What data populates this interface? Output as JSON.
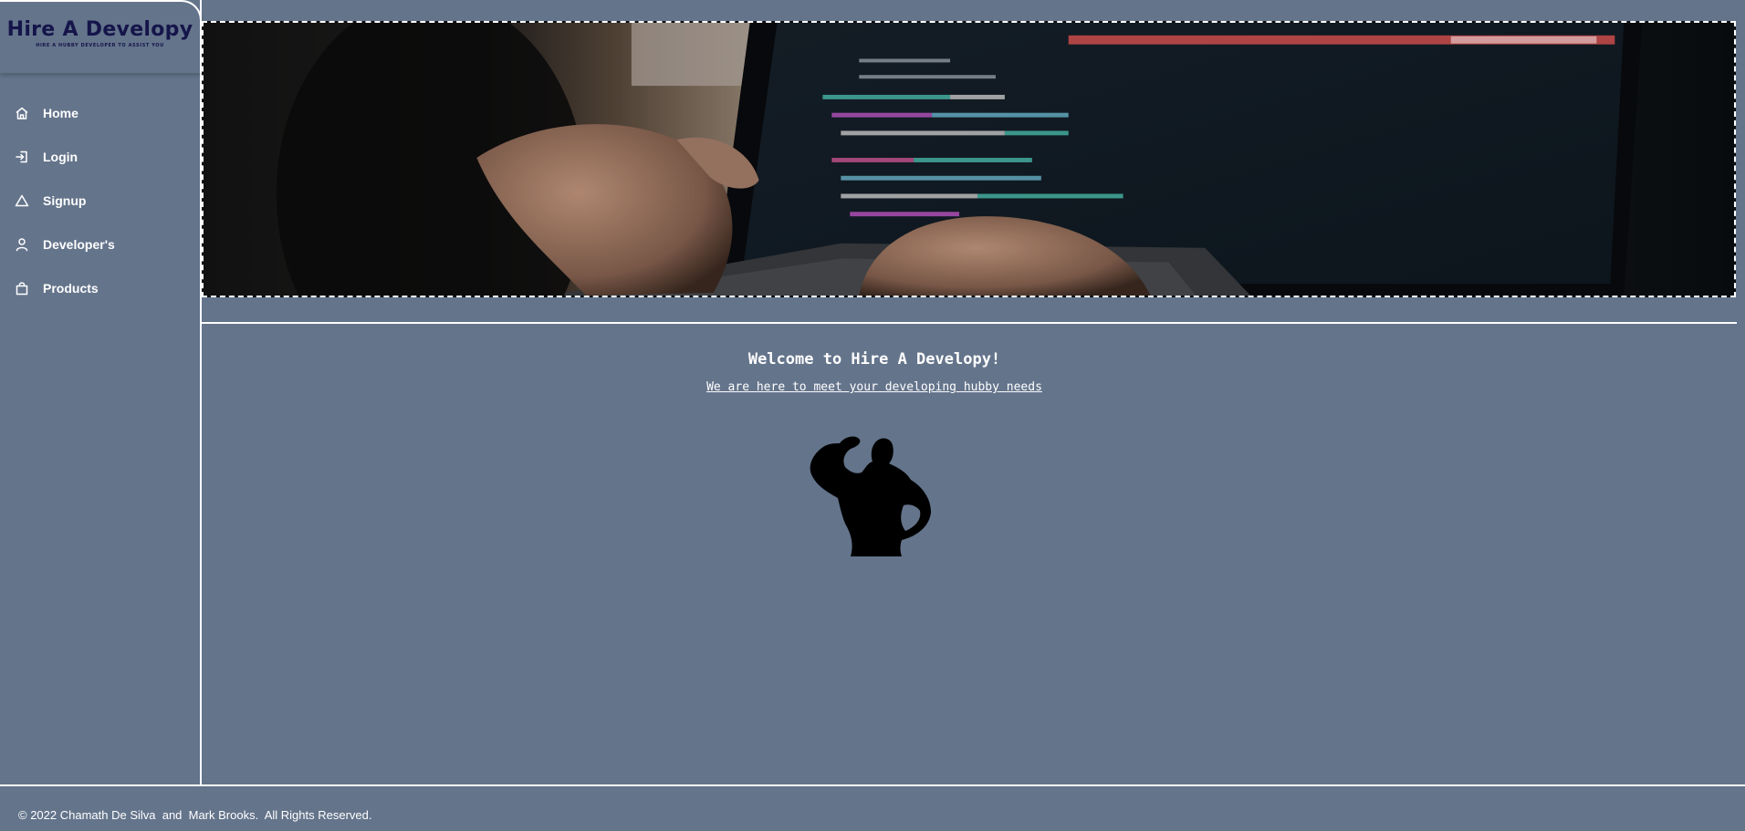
{
  "brand": {
    "title": "Hire A Developy",
    "tagline": "HIRE A HUBBY DEVELOPER TO ASSIST YOU"
  },
  "nav": {
    "items": [
      {
        "label": "Home",
        "icon": "home-icon"
      },
      {
        "label": "Login",
        "icon": "login-icon"
      },
      {
        "label": "Signup",
        "icon": "signup-triangle-icon"
      },
      {
        "label": "Developer's",
        "icon": "user-icon"
      },
      {
        "label": "Products",
        "icon": "shopping-bag-icon"
      }
    ]
  },
  "main": {
    "welcome_title": "Welcome to Hire A Developy!",
    "welcome_subtitle": "We are here to meet your developing hubby needs"
  },
  "footer": {
    "copyright": "© 2022 Chamath De Silva  and  Mark Brooks.  All Rights Reserved."
  },
  "colors": {
    "background": "#64748b",
    "brand_text": "#15154a",
    "text": "#ffffff"
  }
}
